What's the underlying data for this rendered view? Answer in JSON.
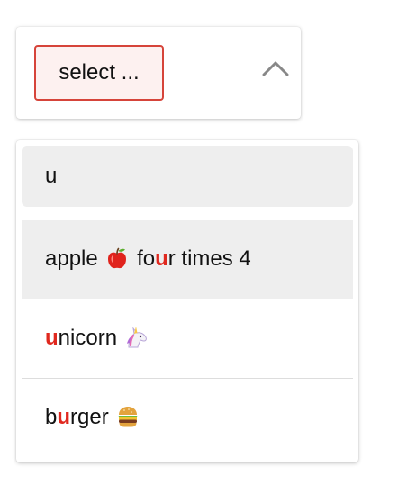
{
  "select": {
    "chip_label": "select ..."
  },
  "search": {
    "value": "u"
  },
  "options": [
    {
      "before": "apple",
      "emoji": "apple-emoji",
      "mid": " fo",
      "match": "u",
      "after": "r times 4"
    },
    {
      "before": "",
      "match": "u",
      "after": "nicorn",
      "emoji": "unicorn-emoji"
    },
    {
      "before": "b",
      "match": "u",
      "after": "rger",
      "emoji": "burger-emoji"
    }
  ],
  "colors": {
    "accent": "#d6443a",
    "chip_background": "#fdf1f0",
    "highlight": "#eeeeee",
    "match_text": "#e0281e"
  }
}
